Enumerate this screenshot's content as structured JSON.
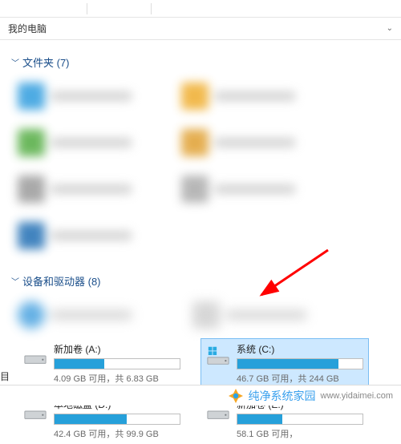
{
  "toolbar_dividers": [
    108,
    188
  ],
  "location": "我的电脑",
  "sections": {
    "folders": {
      "title": "文件夹 (7)"
    },
    "devices": {
      "title": "设备和驱动器 (8)"
    }
  },
  "drives": [
    {
      "name": "新加卷 (A:)",
      "status": "4.09 GB 可用，共 6.83 GB",
      "fill_pct": 40,
      "selected": false,
      "os": false
    },
    {
      "name": "系统 (C:)",
      "status": "46.7 GB 可用，共 244 GB",
      "fill_pct": 81,
      "selected": true,
      "os": true
    },
    {
      "name": "本地磁盘 (D:)",
      "status": "42.4 GB 可用，共 99.9 GB",
      "fill_pct": 58,
      "selected": false,
      "os": false
    },
    {
      "name": "新加卷 (E:)",
      "status": "58.1 GB 可用，",
      "fill_pct": 36,
      "selected": false,
      "os": false
    }
  ],
  "corner_text": "目",
  "watermark": {
    "brand": "纯净系统家园",
    "url": "www.yidaimei.com"
  }
}
